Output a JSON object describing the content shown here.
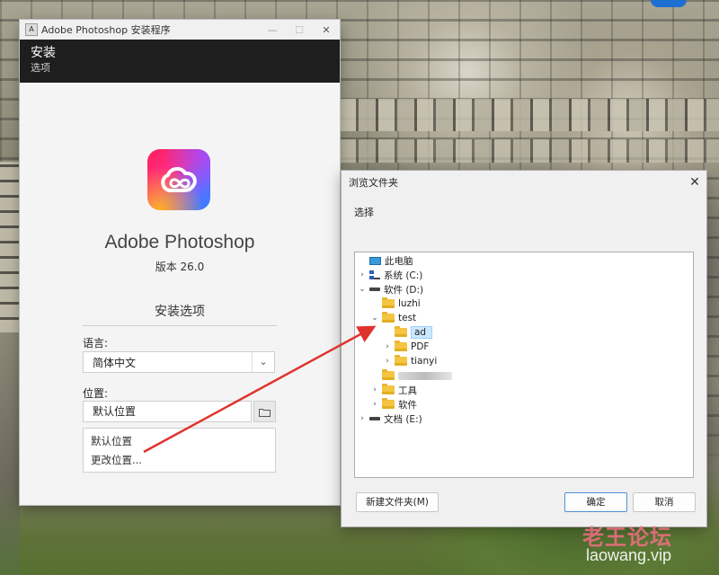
{
  "installer": {
    "window_title": "Adobe Photoshop 安装程序",
    "app_icon_text": "A",
    "header_title": "安装",
    "header_subtitle": "选项",
    "product_name": "Adobe Photoshop",
    "version": "版本 26.0",
    "options_title": "安装选项",
    "language_label": "语言:",
    "language_value": "简体中文",
    "location_label": "位置:",
    "location_value": "默认位置",
    "location_menu": [
      "默认位置",
      "更改位置..."
    ],
    "controls": {
      "minimize": "—",
      "maximize": "☐",
      "close": "✕"
    }
  },
  "browse_dialog": {
    "title": "浏览文件夹",
    "prompt": "选择",
    "tree": [
      {
        "label": "此电脑",
        "icon": "pc-icon",
        "expander": ""
      },
      {
        "label": "系统 (C:)",
        "icon": "system-drive-icon",
        "expander": ">"
      },
      {
        "label": "软件 (D:)",
        "icon": "drive-icon",
        "expander": "v"
      },
      {
        "label": "luzhi",
        "icon": "folder-icon",
        "expander": ""
      },
      {
        "label": "test",
        "icon": "folder-icon",
        "expander": "v"
      },
      {
        "label": "ad",
        "icon": "folder-icon",
        "expander": "",
        "selected": true
      },
      {
        "label": "PDF",
        "icon": "folder-icon",
        "expander": ">"
      },
      {
        "label": "tianyi",
        "icon": "folder-icon",
        "expander": ">"
      },
      {
        "label": "",
        "icon": "folder-icon",
        "expander": "",
        "blurred": true
      },
      {
        "label": "工具",
        "icon": "folder-icon",
        "expander": ">"
      },
      {
        "label": "软件",
        "icon": "folder-icon",
        "expander": ">"
      },
      {
        "label": "文档 (E:)",
        "icon": "drive-icon",
        "expander": ">"
      }
    ],
    "new_folder_button": "新建文件夹(M)",
    "ok_button": "确定",
    "cancel_button": "取消",
    "close": "✕"
  },
  "watermark": {
    "main": "老王论坛",
    "url": "laowang.vip"
  },
  "colors": {
    "annotation_arrow": "#e0332e",
    "header_bg": "#1e1e1e",
    "selection": "#cce8ff"
  }
}
